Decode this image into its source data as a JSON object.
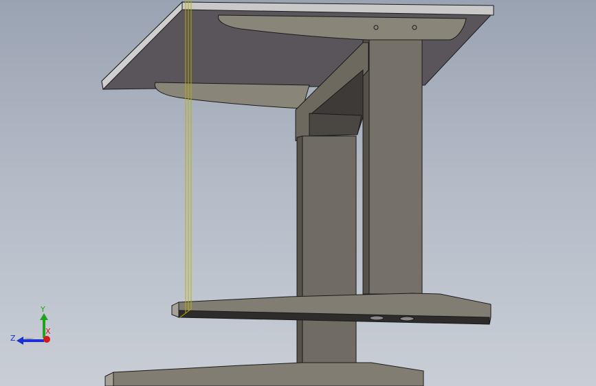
{
  "viewport": {
    "background_top": "#9aa3b2",
    "background_bottom": "#c9ced6",
    "edge_color": "#1a1a1a",
    "sketch_line_color": "#b7b000"
  },
  "model": {
    "parts": [
      {
        "name": "tabletop",
        "color": "#5a555a"
      },
      {
        "name": "tabletop-edge",
        "color": "#c6c6c6"
      },
      {
        "name": "top-support-arm",
        "color": "#8c877c"
      },
      {
        "name": "column",
        "color": "#6f6a62"
      },
      {
        "name": "bracket",
        "color": "#6b665d"
      },
      {
        "name": "foot",
        "color": "#6d685f"
      }
    ]
  },
  "triad": {
    "x_label": "X",
    "y_label": "Y",
    "z_label": "Z",
    "x_color": "#d61a1a",
    "y_color": "#1fa31f",
    "z_color": "#1a2fd6"
  }
}
